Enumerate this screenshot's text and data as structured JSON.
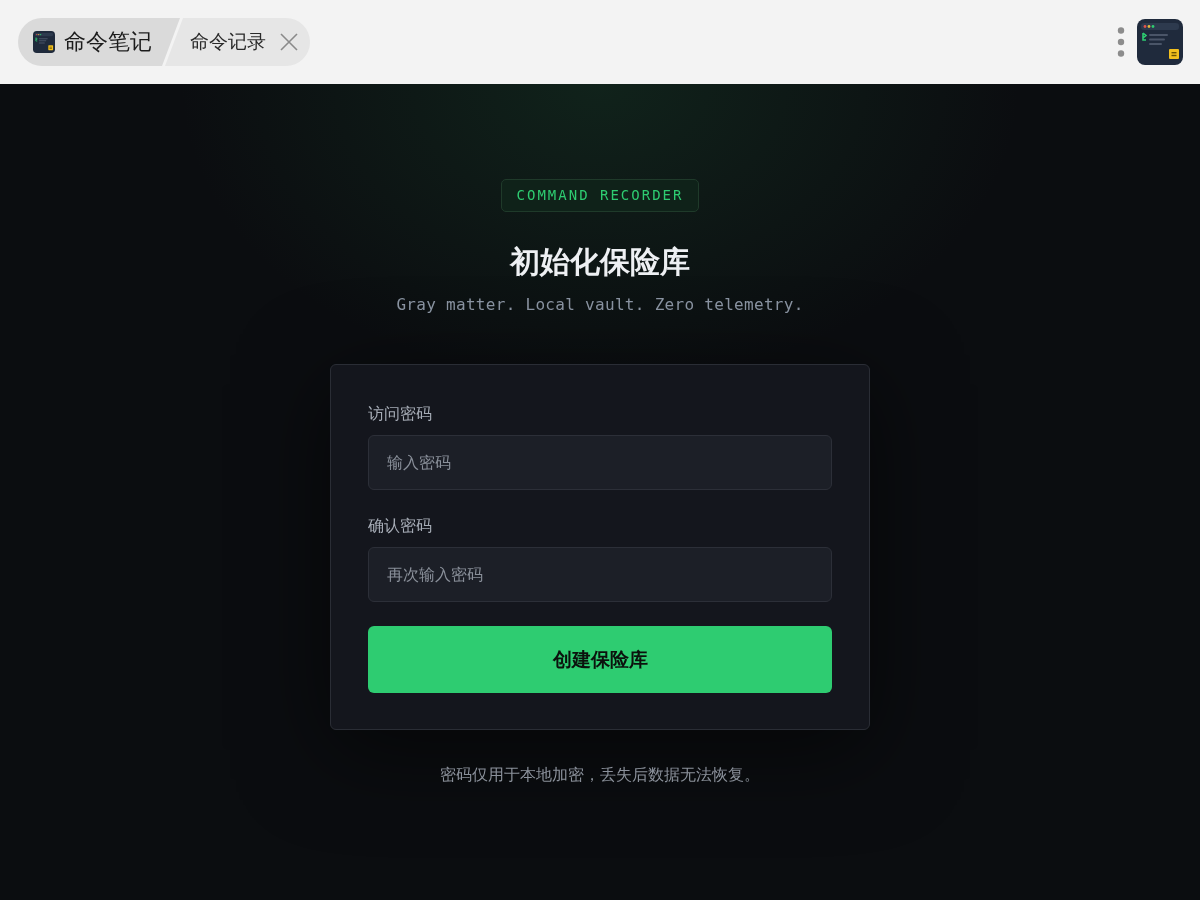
{
  "titlebar": {
    "app_name": "命令笔记",
    "tab": {
      "label": "命令记录"
    }
  },
  "badge": "COMMAND RECORDER",
  "title": "初始化保险库",
  "subtitle": "Gray matter. Local vault. Zero telemetry.",
  "form": {
    "fields": [
      {
        "label": "访问密码",
        "placeholder": "输入密码"
      },
      {
        "label": "确认密码",
        "placeholder": "再次输入密码"
      }
    ],
    "submit": "创建保险库"
  },
  "note": "密码仅用于本地加密，丢失后数据无法恢复。"
}
